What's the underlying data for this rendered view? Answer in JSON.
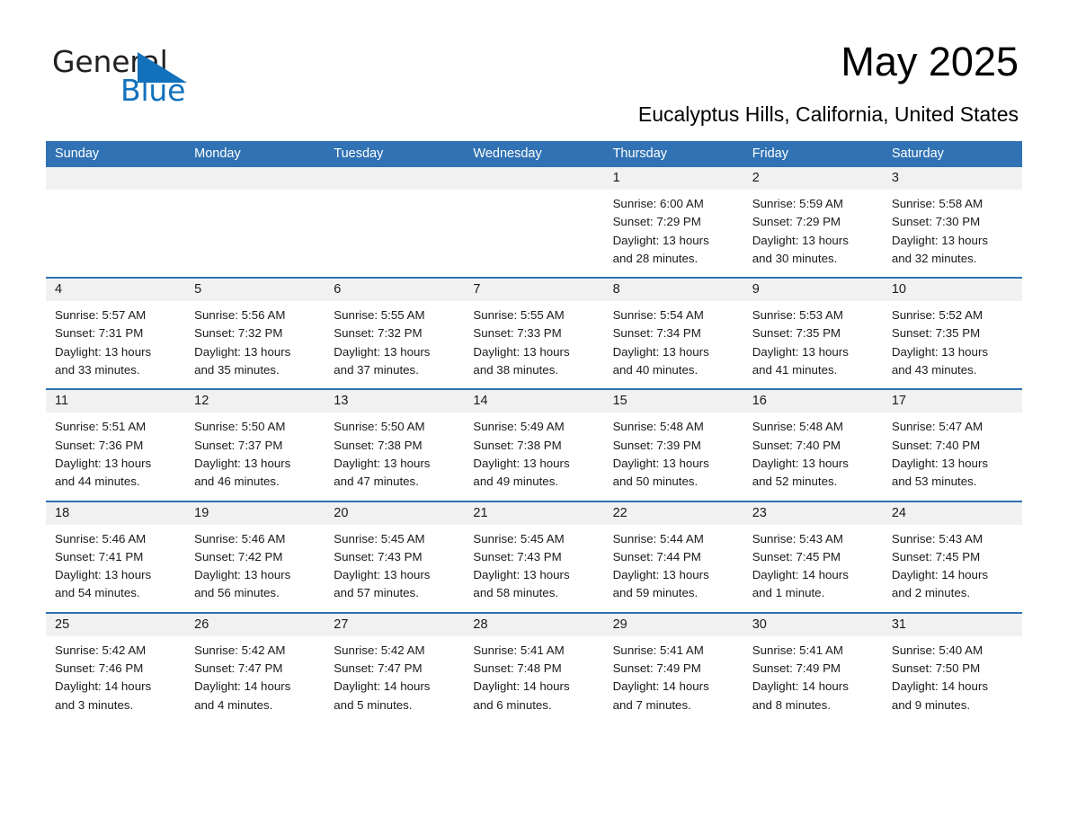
{
  "brand": {
    "word1": "General",
    "word2": "Blue",
    "triangle_color": "#1271bc",
    "text_color": "#231f20"
  },
  "header": {
    "month_title": "May 2025",
    "location": "Eucalyptus Hills, California, United States"
  },
  "theme": {
    "header_blue": "#3072b3",
    "day_strip_gray": "#f1f1f1",
    "text": "#1a1a1a"
  },
  "calendar": {
    "weekdays": [
      "Sunday",
      "Monday",
      "Tuesday",
      "Wednesday",
      "Thursday",
      "Friday",
      "Saturday"
    ],
    "weeks": [
      [
        {
          "day": "",
          "empty": true
        },
        {
          "day": "",
          "empty": true
        },
        {
          "day": "",
          "empty": true
        },
        {
          "day": "",
          "empty": true
        },
        {
          "day": "1",
          "sunrise": "Sunrise: 6:00 AM",
          "sunset": "Sunset: 7:29 PM",
          "daylight1": "Daylight: 13 hours",
          "daylight2": "and 28 minutes."
        },
        {
          "day": "2",
          "sunrise": "Sunrise: 5:59 AM",
          "sunset": "Sunset: 7:29 PM",
          "daylight1": "Daylight: 13 hours",
          "daylight2": "and 30 minutes."
        },
        {
          "day": "3",
          "sunrise": "Sunrise: 5:58 AM",
          "sunset": "Sunset: 7:30 PM",
          "daylight1": "Daylight: 13 hours",
          "daylight2": "and 32 minutes."
        }
      ],
      [
        {
          "day": "4",
          "sunrise": "Sunrise: 5:57 AM",
          "sunset": "Sunset: 7:31 PM",
          "daylight1": "Daylight: 13 hours",
          "daylight2": "and 33 minutes."
        },
        {
          "day": "5",
          "sunrise": "Sunrise: 5:56 AM",
          "sunset": "Sunset: 7:32 PM",
          "daylight1": "Daylight: 13 hours",
          "daylight2": "and 35 minutes."
        },
        {
          "day": "6",
          "sunrise": "Sunrise: 5:55 AM",
          "sunset": "Sunset: 7:32 PM",
          "daylight1": "Daylight: 13 hours",
          "daylight2": "and 37 minutes."
        },
        {
          "day": "7",
          "sunrise": "Sunrise: 5:55 AM",
          "sunset": "Sunset: 7:33 PM",
          "daylight1": "Daylight: 13 hours",
          "daylight2": "and 38 minutes."
        },
        {
          "day": "8",
          "sunrise": "Sunrise: 5:54 AM",
          "sunset": "Sunset: 7:34 PM",
          "daylight1": "Daylight: 13 hours",
          "daylight2": "and 40 minutes."
        },
        {
          "day": "9",
          "sunrise": "Sunrise: 5:53 AM",
          "sunset": "Sunset: 7:35 PM",
          "daylight1": "Daylight: 13 hours",
          "daylight2": "and 41 minutes."
        },
        {
          "day": "10",
          "sunrise": "Sunrise: 5:52 AM",
          "sunset": "Sunset: 7:35 PM",
          "daylight1": "Daylight: 13 hours",
          "daylight2": "and 43 minutes."
        }
      ],
      [
        {
          "day": "11",
          "sunrise": "Sunrise: 5:51 AM",
          "sunset": "Sunset: 7:36 PM",
          "daylight1": "Daylight: 13 hours",
          "daylight2": "and 44 minutes."
        },
        {
          "day": "12",
          "sunrise": "Sunrise: 5:50 AM",
          "sunset": "Sunset: 7:37 PM",
          "daylight1": "Daylight: 13 hours",
          "daylight2": "and 46 minutes."
        },
        {
          "day": "13",
          "sunrise": "Sunrise: 5:50 AM",
          "sunset": "Sunset: 7:38 PM",
          "daylight1": "Daylight: 13 hours",
          "daylight2": "and 47 minutes."
        },
        {
          "day": "14",
          "sunrise": "Sunrise: 5:49 AM",
          "sunset": "Sunset: 7:38 PM",
          "daylight1": "Daylight: 13 hours",
          "daylight2": "and 49 minutes."
        },
        {
          "day": "15",
          "sunrise": "Sunrise: 5:48 AM",
          "sunset": "Sunset: 7:39 PM",
          "daylight1": "Daylight: 13 hours",
          "daylight2": "and 50 minutes."
        },
        {
          "day": "16",
          "sunrise": "Sunrise: 5:48 AM",
          "sunset": "Sunset: 7:40 PM",
          "daylight1": "Daylight: 13 hours",
          "daylight2": "and 52 minutes."
        },
        {
          "day": "17",
          "sunrise": "Sunrise: 5:47 AM",
          "sunset": "Sunset: 7:40 PM",
          "daylight1": "Daylight: 13 hours",
          "daylight2": "and 53 minutes."
        }
      ],
      [
        {
          "day": "18",
          "sunrise": "Sunrise: 5:46 AM",
          "sunset": "Sunset: 7:41 PM",
          "daylight1": "Daylight: 13 hours",
          "daylight2": "and 54 minutes."
        },
        {
          "day": "19",
          "sunrise": "Sunrise: 5:46 AM",
          "sunset": "Sunset: 7:42 PM",
          "daylight1": "Daylight: 13 hours",
          "daylight2": "and 56 minutes."
        },
        {
          "day": "20",
          "sunrise": "Sunrise: 5:45 AM",
          "sunset": "Sunset: 7:43 PM",
          "daylight1": "Daylight: 13 hours",
          "daylight2": "and 57 minutes."
        },
        {
          "day": "21",
          "sunrise": "Sunrise: 5:45 AM",
          "sunset": "Sunset: 7:43 PM",
          "daylight1": "Daylight: 13 hours",
          "daylight2": "and 58 minutes."
        },
        {
          "day": "22",
          "sunrise": "Sunrise: 5:44 AM",
          "sunset": "Sunset: 7:44 PM",
          "daylight1": "Daylight: 13 hours",
          "daylight2": "and 59 minutes."
        },
        {
          "day": "23",
          "sunrise": "Sunrise: 5:43 AM",
          "sunset": "Sunset: 7:45 PM",
          "daylight1": "Daylight: 14 hours",
          "daylight2": "and 1 minute."
        },
        {
          "day": "24",
          "sunrise": "Sunrise: 5:43 AM",
          "sunset": "Sunset: 7:45 PM",
          "daylight1": "Daylight: 14 hours",
          "daylight2": "and 2 minutes."
        }
      ],
      [
        {
          "day": "25",
          "sunrise": "Sunrise: 5:42 AM",
          "sunset": "Sunset: 7:46 PM",
          "daylight1": "Daylight: 14 hours",
          "daylight2": "and 3 minutes."
        },
        {
          "day": "26",
          "sunrise": "Sunrise: 5:42 AM",
          "sunset": "Sunset: 7:47 PM",
          "daylight1": "Daylight: 14 hours",
          "daylight2": "and 4 minutes."
        },
        {
          "day": "27",
          "sunrise": "Sunrise: 5:42 AM",
          "sunset": "Sunset: 7:47 PM",
          "daylight1": "Daylight: 14 hours",
          "daylight2": "and 5 minutes."
        },
        {
          "day": "28",
          "sunrise": "Sunrise: 5:41 AM",
          "sunset": "Sunset: 7:48 PM",
          "daylight1": "Daylight: 14 hours",
          "daylight2": "and 6 minutes."
        },
        {
          "day": "29",
          "sunrise": "Sunrise: 5:41 AM",
          "sunset": "Sunset: 7:49 PM",
          "daylight1": "Daylight: 14 hours",
          "daylight2": "and 7 minutes."
        },
        {
          "day": "30",
          "sunrise": "Sunrise: 5:41 AM",
          "sunset": "Sunset: 7:49 PM",
          "daylight1": "Daylight: 14 hours",
          "daylight2": "and 8 minutes."
        },
        {
          "day": "31",
          "sunrise": "Sunrise: 5:40 AM",
          "sunset": "Sunset: 7:50 PM",
          "daylight1": "Daylight: 14 hours",
          "daylight2": "and 9 minutes."
        }
      ]
    ]
  }
}
